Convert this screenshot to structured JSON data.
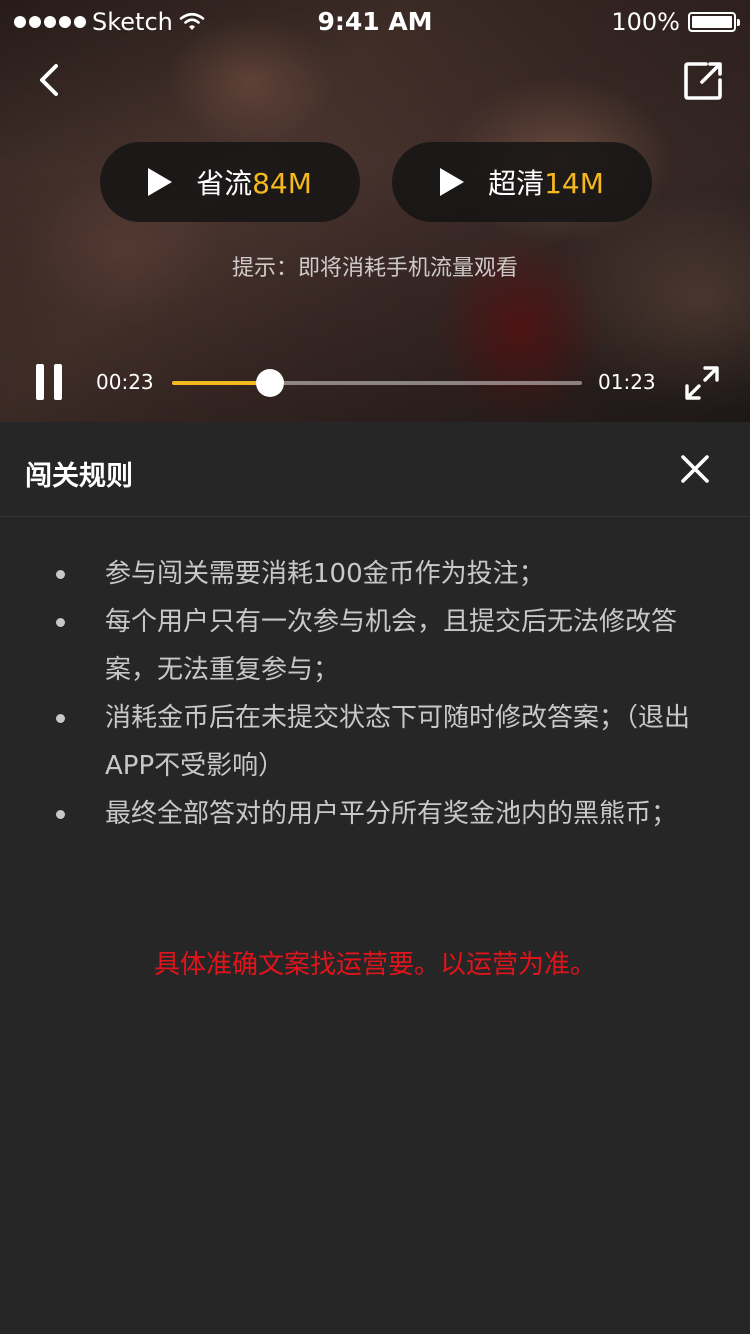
{
  "status_bar": {
    "carrier": "Sketch",
    "time": "9:41 AM",
    "battery": "100%"
  },
  "video": {
    "quality_options": [
      {
        "label": "省流",
        "size": "84M"
      },
      {
        "label": "超清",
        "size": "14M"
      }
    ],
    "hint": "提示：即将消耗手机流量观看",
    "current_time": "00:23",
    "duration": "01:23",
    "progress": 0.24
  },
  "rules_panel": {
    "title": "闯关规则",
    "rules": [
      "参与闯关需要消耗100金币作为投注；",
      "每个用户只有一次参与机会，且提交后无法修改答案，无法重复参与；",
      "消耗金币后在未提交状态下可随时修改答案；（退出APP不受影响）",
      "最终全部答对的用户平分所有奖金池内的黑熊币；"
    ],
    "note": "具体准确文案找运营要。以运营为准。"
  },
  "colors": {
    "accent": "#f5b81e",
    "note": "#e1141b",
    "panel_bg": "#262626"
  },
  "icons": [
    "back-icon",
    "share-icon",
    "play-icon",
    "pause-icon",
    "fullscreen-icon",
    "close-icon",
    "wifi-icon",
    "battery-icon",
    "signal-icon"
  ]
}
